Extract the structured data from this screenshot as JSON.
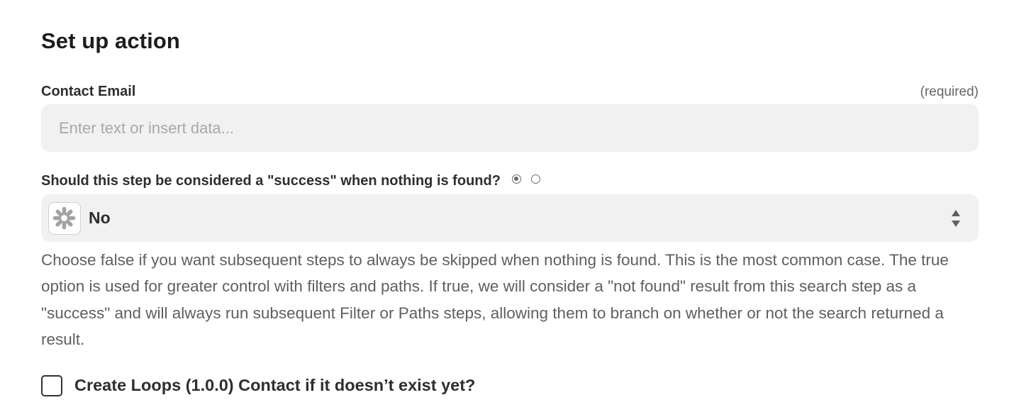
{
  "section": {
    "title": "Set up action"
  },
  "contact_email": {
    "label": "Contact Email",
    "required_note": "(required)",
    "value": "",
    "placeholder": "Enter text or insert data..."
  },
  "success_question": {
    "label": "Should this step be considered a \"success\" when nothing is found?",
    "mode_options": [
      "select-mode",
      "custom-mode"
    ],
    "selected_mode_index": 0,
    "select": {
      "value": "No",
      "icon": "zapier-asterisk-icon",
      "arrows_icon": "up-down-chevron-icon"
    },
    "help_text": "Choose false if you want subsequent steps to always be skipped when nothing is found. This is the most common case. The true option is used for greater control with filters and paths. If true, we will consider a \"not found\" result from this search step as a \"success\" and will always run subsequent Filter or Paths steps, allowing them to branch on whether or not the search returned a result."
  },
  "create_contact": {
    "label": "Create Loops (1.0.0) Contact if it doesn’t exist yet?",
    "checked": false
  },
  "colors": {
    "field_background": "#f1f1f1",
    "text": "#2d2e2e",
    "muted_text": "#5f5f5f",
    "placeholder": "#a9a9a9",
    "icon_gray": "#a3a3a3"
  }
}
